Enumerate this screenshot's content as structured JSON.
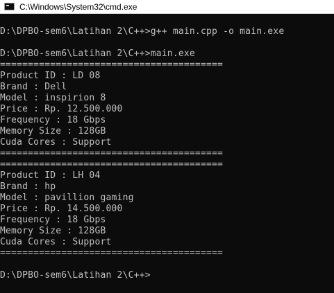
{
  "window": {
    "title": "C:\\Windows\\System32\\cmd.exe",
    "icon": "cmd-console-icon"
  },
  "console": {
    "lines": [
      "",
      "D:\\DPBO-sem6\\Latihan 2\\C++>g++ main.cpp -o main.exe",
      "",
      "D:\\DPBO-sem6\\Latihan 2\\C++>main.exe",
      "========================================",
      "Product ID : LD 08",
      "Brand : Dell",
      "Model : inspirion 8",
      "Price : Rp. 12.500.000",
      "Frequency : 18 Gbps",
      "Memory Size : 128GB",
      "Cuda Cores : Support",
      "========================================",
      "========================================",
      "Product ID : LH 04",
      "Brand : hp",
      "Model : pavillion gaming",
      "Price : Rp. 14.500.000",
      "Frequency : 18 Gbps",
      "Memory Size : 128GB",
      "Cuda Cores : Support",
      "========================================",
      "",
      "D:\\DPBO-sem6\\Latihan 2\\C++>"
    ]
  },
  "colors": {
    "background": "#0c0c0c",
    "text": "#c0c0c0",
    "titlebar": "#ffffff"
  }
}
